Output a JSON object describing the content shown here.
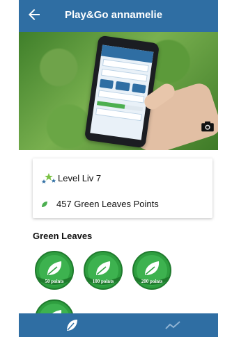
{
  "header": {
    "title": "Play&Go annamelie",
    "back_icon": "back-arrow-icon"
  },
  "hero": {
    "camera_icon": "camera-icon"
  },
  "stats": {
    "level_text": "Level Liv 7",
    "points_text": "457 Green Leaves Points"
  },
  "green_leaves": {
    "title": "Green Leaves",
    "badges": [
      {
        "label": "50 points"
      },
      {
        "label": "100 points"
      },
      {
        "label": "200 points"
      },
      {
        "label": ""
      }
    ]
  },
  "bottom_nav": {
    "left_icon": "leaf-icon",
    "right_icon": "trend-chart-icon"
  },
  "colors": {
    "primary": "#2f6ea3",
    "badge_green": "#2e9e3f"
  }
}
